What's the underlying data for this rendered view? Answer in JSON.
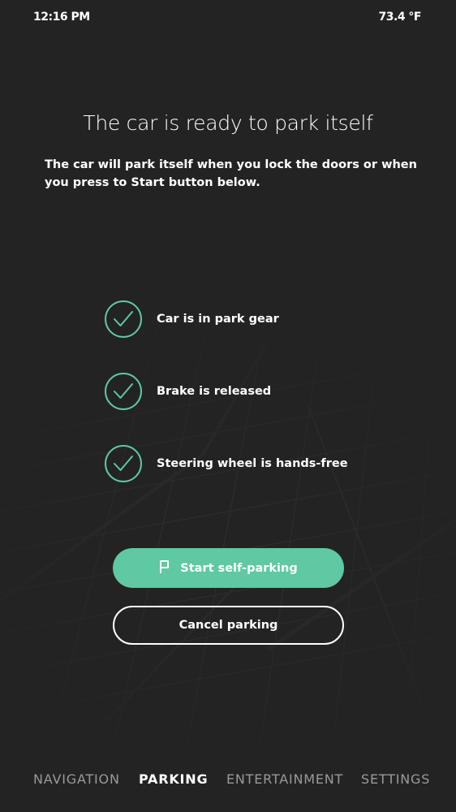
{
  "status_bar": {
    "time": "12:16 PM",
    "temperature": "73.4 °F"
  },
  "main": {
    "title": "The car is ready to park itself",
    "subtitle": "The car will park itself when you lock the doors or when you press to Start button below.",
    "checklist": [
      {
        "label": "Car is in park gear",
        "icon": "check-icon"
      },
      {
        "label": "Brake is released",
        "icon": "check-icon"
      },
      {
        "label": "Steering wheel is hands-free",
        "icon": "check-icon"
      }
    ],
    "start_button": {
      "label": "Start self-parking",
      "icon": "parking-flag-icon"
    },
    "cancel_button": {
      "label": "Cancel parking"
    }
  },
  "nav": {
    "items": [
      {
        "label": "NAVIGATION",
        "active": false
      },
      {
        "label": "PARKING",
        "active": true
      },
      {
        "label": "ENTERTAINMENT",
        "active": false
      },
      {
        "label": "SETTINGS",
        "active": false
      }
    ]
  },
  "colors": {
    "background": "#232323",
    "accent": "#5ec9a3",
    "text": "#ffffff",
    "nav_inactive": "#9a9a9a",
    "map_lines": "#2f2f2f"
  }
}
